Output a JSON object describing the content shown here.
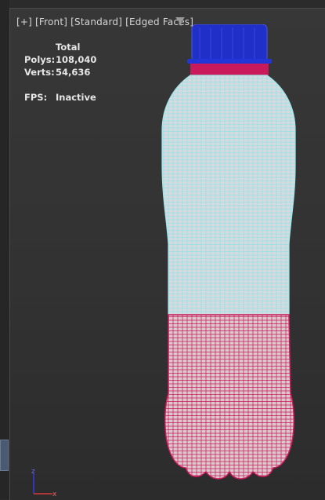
{
  "viewport": {
    "label_parts": [
      "[+]",
      "[Front]",
      "[Standard]",
      "[Edged Faces]"
    ],
    "filter_icon": "funnel-icon"
  },
  "stats": {
    "header": "Total",
    "polys_label": "Polys:",
    "polys_value": "108,040",
    "verts_label": "Verts:",
    "verts_value": "54,636",
    "fps_label": "FPS:",
    "fps_value": "Inactive"
  },
  "colors": {
    "cap": "#1f2fc8",
    "upper_wire": "#9ee6ec",
    "lower_wire": "#c8195a",
    "bottle_fill": "#d8c8cc"
  },
  "axis_gizmo": {
    "axes": [
      "z",
      "x"
    ]
  }
}
